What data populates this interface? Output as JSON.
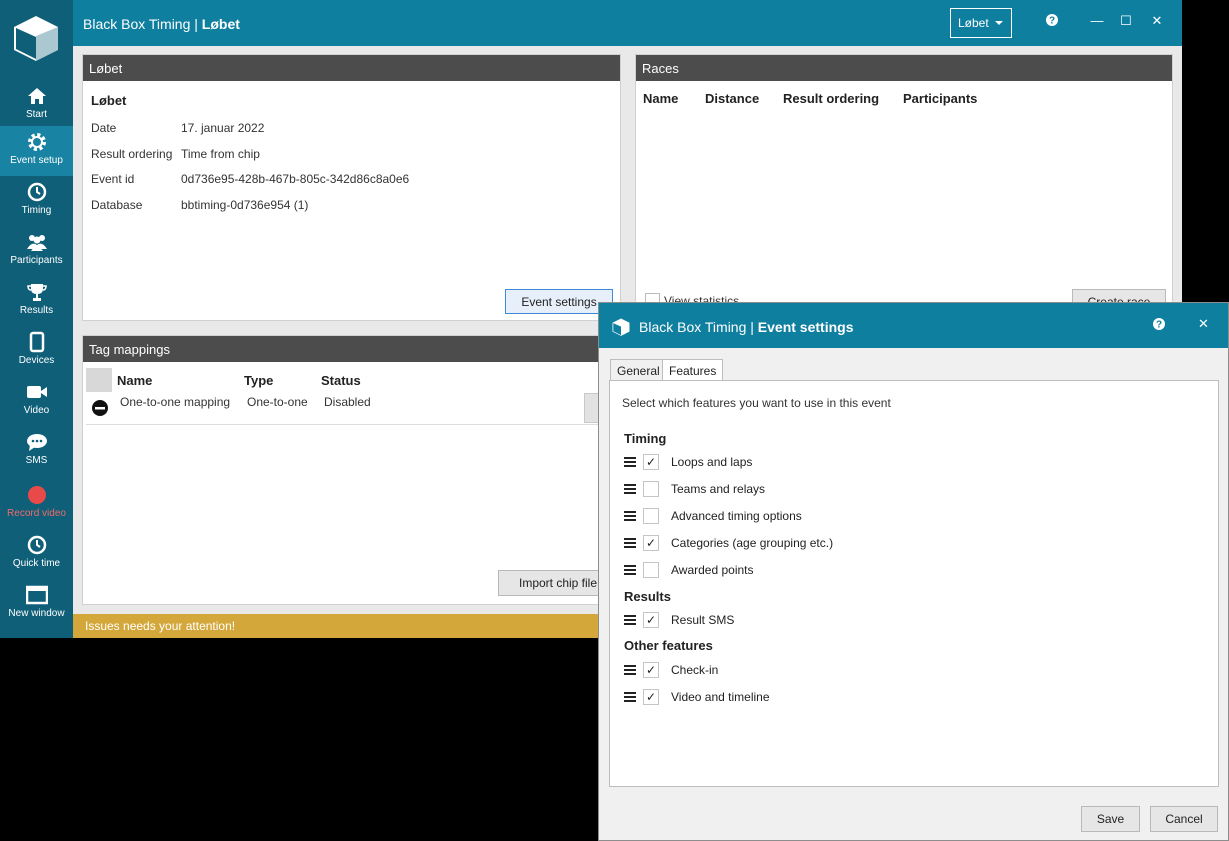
{
  "main_window": {
    "app_name": "Black Box Timing",
    "separator": " | ",
    "event_name": "Løbet",
    "event_select": "Løbet",
    "help": "?",
    "minimize": "—",
    "maximize": "☐",
    "close": "✕"
  },
  "sidebar": {
    "items": [
      {
        "label": "Start",
        "icon": "home-icon"
      },
      {
        "label": "Event setup",
        "icon": "gear-icon"
      },
      {
        "label": "Timing",
        "icon": "clock-icon"
      },
      {
        "label": "Participants",
        "icon": "users-icon"
      },
      {
        "label": "Results",
        "icon": "trophy-icon"
      },
      {
        "label": "Devices",
        "icon": "device-icon"
      },
      {
        "label": "Video",
        "icon": "video-icon"
      },
      {
        "label": "SMS",
        "icon": "chat-icon"
      },
      {
        "label": "Record video",
        "icon": "record-icon"
      },
      {
        "label": "Quick time",
        "icon": "clock-icon"
      },
      {
        "label": "New window",
        "icon": "window-icon"
      }
    ]
  },
  "event_panel": {
    "header": "Løbet",
    "name": "Løbet",
    "rows": [
      {
        "label": "Date",
        "value": "17. januar 2022"
      },
      {
        "label": "Result ordering",
        "value": "Time from chip"
      },
      {
        "label": "Event id",
        "value": "0d736e95-428b-467b-805c-342d86c8a0e6"
      },
      {
        "label": "Database",
        "value": "bbtiming-0d736e954 (1)"
      }
    ],
    "button": "Event settings"
  },
  "races_panel": {
    "header": "Races",
    "columns": [
      "Name",
      "Distance",
      "Result ordering",
      "Participants"
    ],
    "view_statistics": "View statistics",
    "create_race": "Create race"
  },
  "tag_panel": {
    "header": "Tag mappings",
    "columns": [
      "Name",
      "Type",
      "Status"
    ],
    "rows": [
      {
        "name": "One-to-one mapping",
        "type": "One-to-one",
        "status": "Disabled"
      }
    ],
    "import_button": "Import chip file"
  },
  "status_bar": "Issues needs your attention!",
  "dialog": {
    "app_name": "Black Box Timing",
    "separator": " | ",
    "title": "Event settings",
    "help": "?",
    "close": "✕",
    "tabs": [
      "General",
      "Features"
    ],
    "active_tab": "Features",
    "intro": "Select which features you want to use in this event",
    "sections": [
      {
        "title": "Timing",
        "features": [
          {
            "label": "Loops and laps",
            "checked": true
          },
          {
            "label": "Teams and relays",
            "checked": false
          },
          {
            "label": "Advanced timing options",
            "checked": false
          },
          {
            "label": "Categories (age grouping etc.)",
            "checked": true
          },
          {
            "label": "Awarded points",
            "checked": false
          }
        ]
      },
      {
        "title": "Results",
        "features": [
          {
            "label": "Result SMS",
            "checked": true
          }
        ]
      },
      {
        "title": "Other features",
        "features": [
          {
            "label": "Check-in",
            "checked": true
          },
          {
            "label": "Video and timeline",
            "checked": true
          }
        ]
      }
    ],
    "save": "Save",
    "cancel": "Cancel"
  },
  "colors": {
    "sidebar": "#0f5f78",
    "titlebar": "#0f7fa0",
    "panel_header": "#4c4c4c",
    "status_bar": "#d4a73a"
  }
}
